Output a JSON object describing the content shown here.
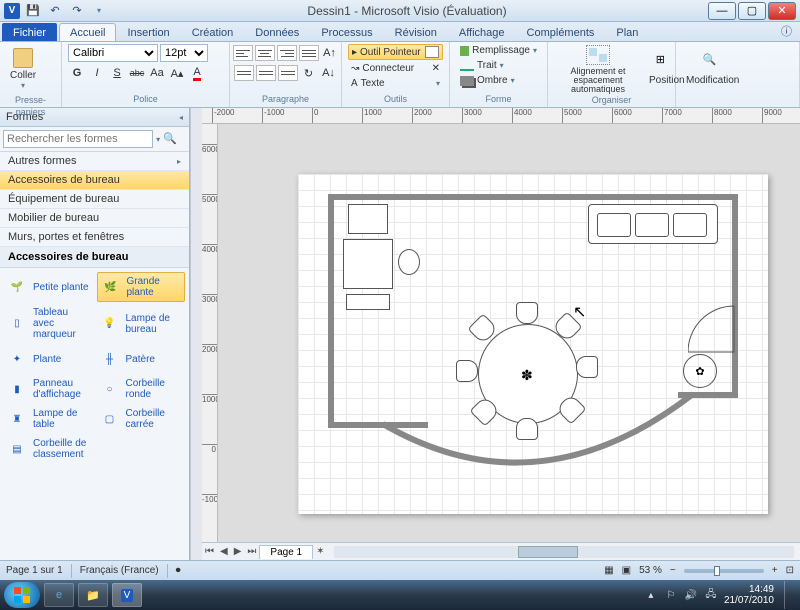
{
  "window": {
    "title": "Dessin1 - Microsoft Visio (Évaluation)"
  },
  "tabs": {
    "file": "Fichier",
    "items": [
      "Accueil",
      "Insertion",
      "Création",
      "Données",
      "Processus",
      "Révision",
      "Affichage",
      "Compléments",
      "Plan"
    ],
    "active": 0
  },
  "ribbon": {
    "clipboard": {
      "paste": "Coller",
      "label": "Presse-papiers"
    },
    "font": {
      "name": "Calibri",
      "size": "12pt",
      "label": "Police",
      "buttons": [
        "G",
        "I",
        "S",
        "abc",
        "Aa"
      ]
    },
    "paragraph": {
      "label": "Paragraphe"
    },
    "tools": {
      "label": "Outils",
      "pointer": "Outil Pointeur",
      "connector": "Connecteur",
      "text": "Texte"
    },
    "shape": {
      "label": "Forme",
      "fill": "Remplissage",
      "line": "Trait",
      "shadow": "Ombre"
    },
    "arrange": {
      "label": "Organiser",
      "align": "Alignement et espacement automatiques",
      "position": "Position"
    },
    "edit": {
      "label": "",
      "modify": "Modification"
    }
  },
  "shapes_panel": {
    "title": "Formes",
    "search_placeholder": "Rechercher les formes",
    "stencils": [
      "Autres formes",
      "Accessoires de bureau",
      "Équipement de bureau",
      "Mobilier de bureau",
      "Murs, portes et fenêtres"
    ],
    "active_stencil": 1,
    "heading": "Accessoires de bureau",
    "shapes": [
      {
        "name": "Petite plante"
      },
      {
        "name": "Grande plante",
        "selected": true
      },
      {
        "name": "Tableau avec marqueur"
      },
      {
        "name": "Lampe de bureau"
      },
      {
        "name": "Plante"
      },
      {
        "name": "Patère"
      },
      {
        "name": "Panneau d'affichage"
      },
      {
        "name": "Corbeille ronde"
      },
      {
        "name": "Lampe de table"
      },
      {
        "name": "Corbeille carrée"
      },
      {
        "name": "Corbeille de classement"
      }
    ]
  },
  "rulers": {
    "h": [
      "-2000",
      "-1000",
      "0",
      "1000",
      "2000",
      "3000",
      "4000",
      "5000",
      "6000",
      "7000",
      "8000",
      "9000"
    ],
    "v": [
      "6000",
      "5000",
      "4000",
      "3000",
      "2000",
      "1000",
      "0",
      "-1000"
    ]
  },
  "page_tabs": {
    "page": "Page 1"
  },
  "status": {
    "pages": "Page 1 sur 1",
    "lang": "Français (France)",
    "zoom": "53 %"
  },
  "taskbar": {
    "time": "14:49",
    "date": "21/07/2010"
  }
}
